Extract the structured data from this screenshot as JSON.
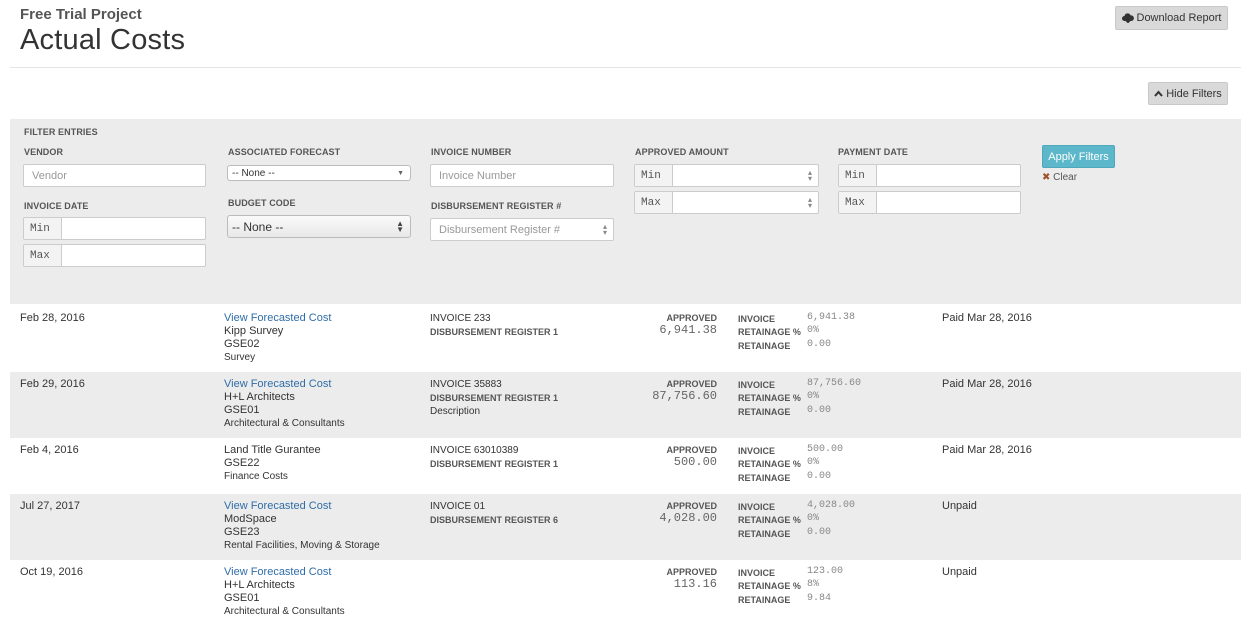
{
  "header": {
    "project": "Free Trial Project",
    "title": "Actual Costs",
    "download_label": "Download Report",
    "hide_filters_label": "Hide Filters"
  },
  "filters": {
    "section_label": "FILTER ENTRIES",
    "vendor_label": "VENDOR",
    "vendor_placeholder": "Vendor",
    "forecast_label": "ASSOCIATED FORECAST",
    "forecast_value": "-- None --",
    "invoice_number_label": "INVOICE NUMBER",
    "invoice_number_placeholder": "Invoice Number",
    "approved_amount_label": "APPROVED AMOUNT",
    "payment_date_label": "PAYMENT DATE",
    "invoice_date_label": "INVOICE DATE",
    "budget_code_label": "BUDGET CODE",
    "budget_code_value": "-- None --",
    "disbursement_label": "DISBURSEMENT REGISTER #",
    "disbursement_placeholder": "Disbursement Register #",
    "min_label": "Min",
    "max_label": "Max",
    "apply_label": "Apply Filters",
    "clear_label": "Clear"
  },
  "labels": {
    "approved": "APPROVED",
    "invoice": "INVOICE",
    "retainage_pct": "RETAINAGE %",
    "retainage": "RETAINAGE"
  },
  "rows": [
    {
      "date": "Feb 28, 2016",
      "link": "View Forecasted Cost",
      "vendor": "Kipp Survey",
      "code": "GSE02",
      "category": "Survey",
      "invoice": "INVOICE 233",
      "register": "DISBURSEMENT REGISTER 1",
      "description": "",
      "approved": "6,941.38",
      "invoice_amt": "6,941.38",
      "retainage_pct": "0%",
      "retainage": "0.00",
      "status": "Paid Mar 28, 2016"
    },
    {
      "date": "Feb 29, 2016",
      "link": "View Forecasted Cost",
      "vendor": "H+L Architects",
      "code": "GSE01",
      "category": "Architectural & Consultants",
      "invoice": "INVOICE 35883",
      "register": "DISBURSEMENT REGISTER 1",
      "description": "Description",
      "approved": "87,756.60",
      "invoice_amt": "87,756.60",
      "retainage_pct": "0%",
      "retainage": "0.00",
      "status": "Paid Mar 28, 2016"
    },
    {
      "date": "Feb 4, 2016",
      "link": "",
      "vendor": "Land Title Gurantee",
      "code": "GSE22",
      "category": "Finance Costs",
      "invoice": "INVOICE 63010389",
      "register": "DISBURSEMENT REGISTER 1",
      "description": "",
      "approved": "500.00",
      "invoice_amt": "500.00",
      "retainage_pct": "0%",
      "retainage": "0.00",
      "status": "Paid Mar 28, 2016"
    },
    {
      "date": "Jul 27, 2017",
      "link": "View Forecasted Cost",
      "vendor": "ModSpace",
      "code": "GSE23",
      "category": "Rental Facilities, Moving & Storage",
      "invoice": "INVOICE 01",
      "register": "DISBURSEMENT REGISTER 6",
      "description": "",
      "approved": "4,028.00",
      "invoice_amt": "4,028.00",
      "retainage_pct": "0%",
      "retainage": "0.00",
      "status": "Unpaid"
    },
    {
      "date": "Oct 19, 2016",
      "link": "View Forecasted Cost",
      "vendor": "H+L Architects",
      "code": "GSE01",
      "category": "Architectural & Consultants",
      "invoice": "",
      "register": "",
      "description": "",
      "approved": "113.16",
      "invoice_amt": "123.00",
      "retainage_pct": "8%",
      "retainage": "9.84",
      "status": "Unpaid"
    }
  ],
  "icons": {
    "download": "cloud-download-icon",
    "hide": "chevron-up-icon",
    "clear": "close-icon"
  }
}
